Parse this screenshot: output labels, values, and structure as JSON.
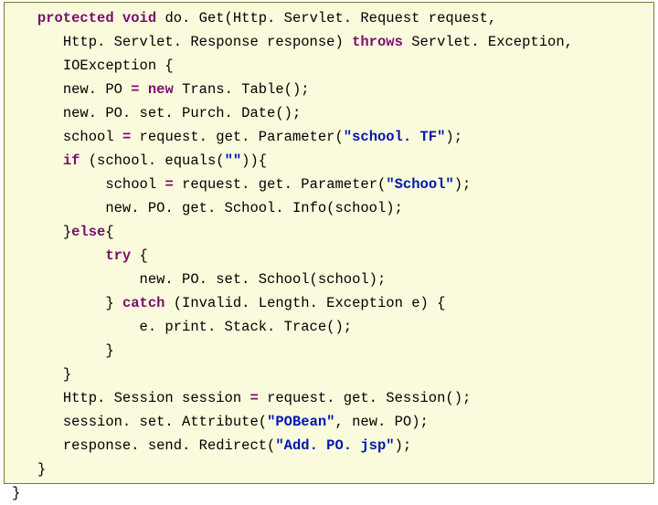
{
  "code": {
    "indent1": "   ",
    "indent2": "      ",
    "indent3": "           ",
    "indent4": "               ",
    "l1": {
      "kw1": "protected void",
      "t1": " do. Get(Http. Servlet. Request request,"
    },
    "l2": {
      "t1": "Http. Servlet. Response response) ",
      "kw1": "throws",
      "t2": " Servlet. Exception,"
    },
    "l3": {
      "t1": "IOException {"
    },
    "l4": {
      "t1": "new. PO ",
      "eq": "=",
      "t2": " ",
      "kw1": "new",
      "t3": " Trans. Table();"
    },
    "l5": {
      "t1": "new. PO. set. Purch. Date();"
    },
    "l6": {
      "t1": "school ",
      "eq": "=",
      "t2": " request. get. Parameter(",
      "s1": "\"school. TF\"",
      "t3": ");"
    },
    "l7": {
      "kw1": "if",
      "t1": " (school. equals(",
      "s1": "\"\"",
      "t2": ")){"
    },
    "l8": {
      "t1": "school ",
      "eq": "=",
      "t2": " request. get. Parameter(",
      "s1": "\"School\"",
      "t3": ");"
    },
    "l9": {
      "t1": "new. PO. get. School. Info(school);"
    },
    "l10": {
      "t1": "}",
      "kw1": "else",
      "t2": "{"
    },
    "l11": {
      "kw1": "try",
      "t1": " {"
    },
    "l12": {
      "t1": "new. PO. set. School(school);"
    },
    "l13": {
      "t1": "} ",
      "kw1": "catch",
      "t2": " (Invalid. Length. Exception e) {"
    },
    "l14": {
      "t1": "e. print. Stack. Trace();"
    },
    "l15": {
      "t1": "}"
    },
    "l16": {
      "t1": "}"
    },
    "l17": {
      "t1": "Http. Session session ",
      "eq": "=",
      "t2": " request. get. Session();"
    },
    "l18": {
      "t1": "session. set. Attribute(",
      "s1": "\"POBean\"",
      "t2": ", new. PO);"
    },
    "l19": {
      "t1": "response. send. Redirect(",
      "s1": "\"Add. PO. jsp\"",
      "t2": ");"
    },
    "l20": {
      "t1": "}"
    },
    "l21": {
      "t1": "}"
    }
  }
}
